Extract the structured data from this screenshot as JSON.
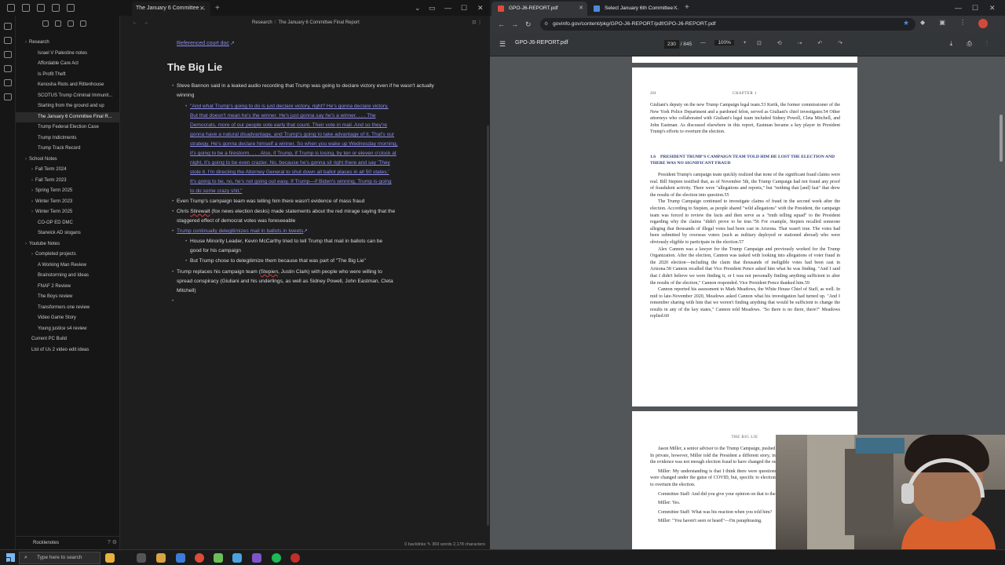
{
  "obsidian": {
    "tab_title": "The January 6 Committee ...",
    "tab_close": "✕",
    "tab_new": "+",
    "win_controls": {
      "chevron": "⌄",
      "restore": "▭",
      "minimize": "—",
      "maximize": "☐",
      "close": "✕"
    },
    "breadcrumb": {
      "folder": "Research",
      "sep": "/",
      "note": "The January 6 Committee Final Report"
    },
    "nav": {
      "back": "←",
      "forward": "→",
      "right_icons": "⊡ ⋮"
    },
    "sidebar": {
      "items": [
        {
          "label": "Research",
          "type": "folder"
        },
        {
          "label": "Israel V Palestine notes",
          "type": "file"
        },
        {
          "label": "Affordable Care Act",
          "type": "file"
        },
        {
          "label": "Is Profit Theft",
          "type": "file"
        },
        {
          "label": "Kenosha Riots and Rittenhouse",
          "type": "file"
        },
        {
          "label": "SCOTUS Trump Criminal Immunit...",
          "type": "file"
        },
        {
          "label": "Starting from the ground and up",
          "type": "file"
        },
        {
          "label": "The January 6 Committee Final R...",
          "type": "file",
          "active": true
        },
        {
          "label": "Trump Federal Election Case",
          "type": "file"
        },
        {
          "label": "Trump Indictments",
          "type": "file"
        },
        {
          "label": "Trump Track Record",
          "type": "file"
        },
        {
          "label": "School Notes",
          "type": "folder"
        },
        {
          "label": "Fall Term 2024",
          "type": "folder"
        },
        {
          "label": "Fall Term 2023",
          "type": "folder"
        },
        {
          "label": "Spring Term 2025",
          "type": "folder"
        },
        {
          "label": "Winter Term 2023",
          "type": "folder"
        },
        {
          "label": "Winter Term 2025",
          "type": "folder"
        },
        {
          "label": "CO-OP ED DMC",
          "type": "file"
        },
        {
          "label": "Starwick AD slogans",
          "type": "file"
        },
        {
          "label": "Youtube Notes",
          "type": "folder"
        },
        {
          "label": "Completed projects",
          "type": "folder"
        },
        {
          "label": "A Working Man Review",
          "type": "file"
        },
        {
          "label": "Brainstorming and Ideas",
          "type": "file"
        },
        {
          "label": "FNAF 2 Review",
          "type": "file"
        },
        {
          "label": "The Boys review",
          "type": "file"
        },
        {
          "label": "Transformers one review",
          "type": "file"
        },
        {
          "label": "Video Game Story",
          "type": "file"
        },
        {
          "label": "Young justice s4 review",
          "type": "file"
        },
        {
          "label": "Current PC Build",
          "type": "file"
        },
        {
          "label": "List of Us 2 video edit ideas",
          "type": "file"
        }
      ],
      "vault_name": "Rocklenotes",
      "vault_icons": "? ⚙"
    },
    "note": {
      "link_top": "Referenced court doc",
      "heading": "The Big Lie",
      "b1": "Steve Bannon said in a leaked audio recording that Trump was going to declare victory even if he wasn't actually winning",
      "quote_lines": [
        "\"And what Trump's going to do is just declare victory, right? He's gonna declare victory.",
        "But that doesn't mean he's the winner. He's just gonna say he's a winner. . . . The",
        "Democrats, more of our people vote early that count. Their vote in mail. And so they're",
        "gonna have a natural disadvantage, and Trump's going to take advantage of it. That's our",
        "strategy. He's gonna declare himself a winner. So when you wake up Wednesday morning,",
        "it's going to be a firestorm. . . . Also, if Trump, if Trump is losing, by ten or eleven o'clock at",
        "night, it's going to be even crazier. No, because he's gonna sit right there and say 'They",
        "stole it. I'm directing the Attorney General to shut down all ballot places in all 50 states.'",
        "It's going to be, no, he's not going out easy. If Trump—if Biden's winning, Trump is going",
        "to do some crazy shit.\""
      ],
      "b2": "Even Trump's campaign team was telling him there wasn't evidence of mass fraud",
      "b3_pre": "Chris ",
      "b3_miss": "Stirewalt",
      "b3_post": " (fox news election desks) made statements about the red mirage saying that the",
      "b3_line2": "staggered effect of democrat votes was foreseeable",
      "b4": "Trump continually delegitimizes mail in ballots in tweets",
      "b5_l1": "House Minority Leader, Kevin McCarthy tried to tell Trump that mail in ballots can be",
      "b5_l2": "good for his campaign",
      "b6": "But Trump chose to delegitimize them because that was part of \"The Big Lie\"",
      "b7_pre": "Trump replaces his campaign team (",
      "b7_miss": "Stepien",
      "b7_post": ", Justin Clark) with people who were willing to",
      "b7_l2": "spread conspiracy (Giuliani and his underlings, as well as Sidney Powell, John Eastman, Cleta",
      "b7_l3": "Mitchell)",
      "empty_bullet": "•",
      "link_icon": "↗"
    },
    "status_bar": "0 backlinks   ✎   369 words  2,178 characters"
  },
  "chrome": {
    "tabs": [
      {
        "title": "GPO-J6-REPORT.pdf",
        "active": true
      },
      {
        "title": "Select January 6th Committee ...",
        "active": false
      }
    ],
    "tab_close": "✕",
    "new_tab": "+",
    "nav": {
      "back": "←",
      "forward": "→",
      "reload": "↻"
    },
    "url": "govinfo.gov/content/pkg/GPO-J6-REPORT/pdf/GPO-J6-REPORT.pdf",
    "url_lock": "⚙",
    "star": "★",
    "ext_icons": "◆ ▣ ⋮",
    "pdf": {
      "menu": "☰",
      "file_name": "GPO-J6-REPORT.pdf",
      "page_current": "230",
      "page_sep": "/",
      "page_total": "845",
      "zoom_minus": "—",
      "zoom": "100%",
      "zoom_plus": "+",
      "tools": "⊡ ⟲ ⇢ ↶ ↷",
      "right_icons": "⤓ ⎙ ⋮"
    },
    "page1": {
      "number": "204",
      "chapter": "CHAPTER 1",
      "para1": "Giuliani's deputy on the new Trump Campaign legal team.53 Kerik, the former commissioner of the New York Police Department and a pardoned felon, served as Giuliani's chief investigator.54 Other attorneys who collaborated with Giuliani's legal team included Sidney Powell, Cleta Mitchell, and John Eastman. As discussed elsewhere in this report, Eastman became a key player in President Trump's efforts to overturn the election.",
      "section_num": "1.6",
      "section_title": "PRESIDENT TRUMP'S CAMPAIGN TEAM TOLD HIM HE LOST THE ELECTION AND THERE WAS NO SIGNIFICANT FRAUD",
      "para2": "President Trump's campaign team quickly realized that none of the significant fraud claims were real. Bill Stepien testified that, as of November 5th, the Trump Campaign had not found any proof of fraudulent activity. There were \"allegations and reports,\" but \"nothing that [and] fast\" that drew the results of the election into question.55",
      "para3": "The Trump Campaign continued to investigate claims of fraud in the second week after the election. According to Stepien, as people shared \"wild allegations\" with the President, the campaign team was forced to review the facts and then serve as a \"truth telling squad\" to the President regarding why the claims \"didn't prove to be true.\"56 For example, Stepien recalled someone alleging that thousands of illegal votes had been cast in Arizona. That wasn't true. The votes had been submitted by overseas voters (such as military deployed or stationed abroad) who were obviously eligible to participate in the election.57",
      "para4": "Alex Cannon was a lawyer for the Trump Campaign and previously worked for the Trump Organization. After the election, Cannon was tasked with looking into allegations of voter fraud in the 2020 election—including the claim that thousands of ineligible votes had been cast in Arizona.58 Cannon recalled that Vice President Pence asked him what he was finding. \"And I said that I didn't believe we were finding it, or I was not personally finding anything sufficient to alter the results of the election,\" Cannon responded. Vice President Pence thanked him.59",
      "para5": "Cannon reported his assessment to Mark Meadows, the White House Chief of Staff, as well. In mid to late-November 2020, Meadows asked Cannon what his investigation had turned up. \"And I remember sharing with him that we weren't finding anything that would be sufficient to change the results in any of the key states,\" Cannon told Meadows. \"So there is no there, there?\" Meadows replied.60"
    },
    "page2": {
      "chapter": "THE BIG LIE",
      "para1": "Jason Miller, a senior advisor to the Trump Campaign, pushed claims of election fraud in public. In private, however, Miller told the President a different story, informing him numerous times that the evidence was not enough election fraud to have changed the outcome.",
      "q1": "Miller: My understanding is that I think there were questions and concerns with the rules that were changed under the guise of COVID, but, specific to election day fraud, there were not enough to overturn the election.",
      "q2": "Committee Staff: And did you give your opinion on that to the President?",
      "q3": "Miller: Yes.",
      "q4": "Committee Staff: What was his reaction when you told him?",
      "q5": "Miller: \"You haven't seen or heard\"—I'm paraphrasing."
    }
  },
  "taskbar": {
    "search_placeholder": "Type here to search",
    "search_icon": "⌕"
  }
}
